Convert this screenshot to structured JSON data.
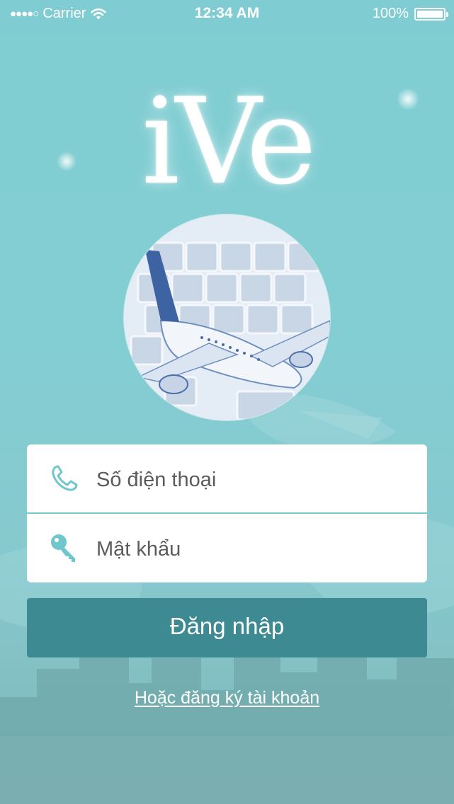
{
  "status_bar": {
    "carrier": "Carrier",
    "signal_dots": "●●●●○",
    "time": "12:34 AM",
    "battery_percent": "100%",
    "battery_level": 1.0
  },
  "app": {
    "logo_text": "iVe"
  },
  "login_form": {
    "phone_placeholder": "Số điện thoại",
    "password_placeholder": "Mật khẩu"
  },
  "actions": {
    "login_label": "Đăng nhập",
    "register_link": "Hoặc đăng ký tài khoản"
  },
  "colors": {
    "background": "#83ced3",
    "accent": "#7ccbd1",
    "button": "#3e8a92",
    "field_text": "#5b5b5b"
  },
  "icons": [
    "wifi-icon",
    "battery-icon",
    "phone-icon",
    "key-icon"
  ]
}
